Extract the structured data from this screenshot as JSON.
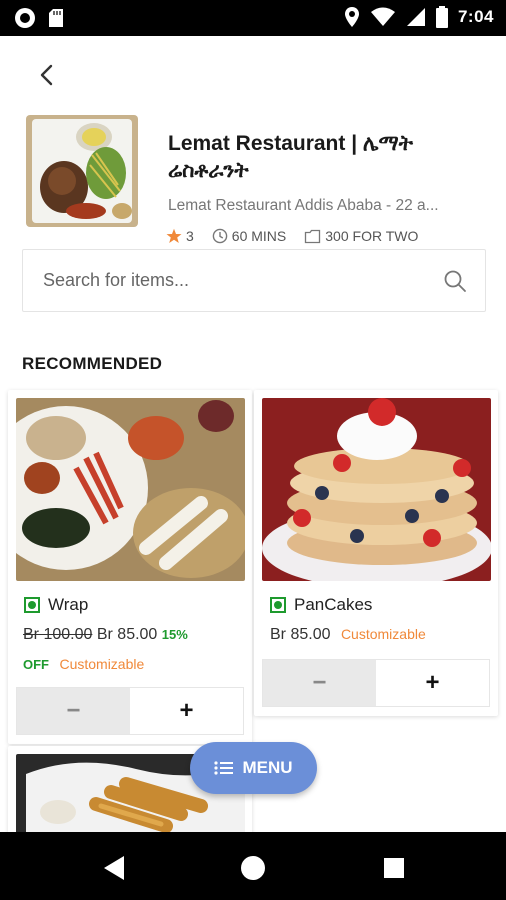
{
  "status_bar": {
    "time": "7:04",
    "icons": [
      "record-icon",
      "sd-card-icon",
      "location-icon",
      "wifi-icon",
      "signal-icon",
      "battery-icon"
    ]
  },
  "header": {
    "back_icon": "chevron-left-icon"
  },
  "restaurant": {
    "name": "Lemat Restaurant | ሌማት ሬስቶራንት",
    "subtitle": "Lemat Restaurant Addis Ababa - 22 a...",
    "rating": "3",
    "delivery_time": "60 MINS",
    "cost_for_two": "300 FOR TWO",
    "accent_color": "#f0893a"
  },
  "search": {
    "placeholder": "Search for items...",
    "value": ""
  },
  "section": {
    "title": "RECOMMENDED"
  },
  "items": [
    {
      "name": "Wrap",
      "old_price": "Br 100.00",
      "price": "Br 85.00",
      "discount": "15%",
      "discount_suffix": "OFF",
      "tag": "Customizable",
      "minus": "−",
      "plus": "+"
    },
    {
      "name": "PanCakes",
      "price": "Br 85.00",
      "tag": "Customizable",
      "minus": "−",
      "plus": "+"
    }
  ],
  "menu_button": {
    "label": "MENU",
    "color": "#6b8fd8"
  },
  "nav": {
    "icons": [
      "back-triangle-icon",
      "home-circle-icon",
      "recents-square-icon"
    ]
  }
}
